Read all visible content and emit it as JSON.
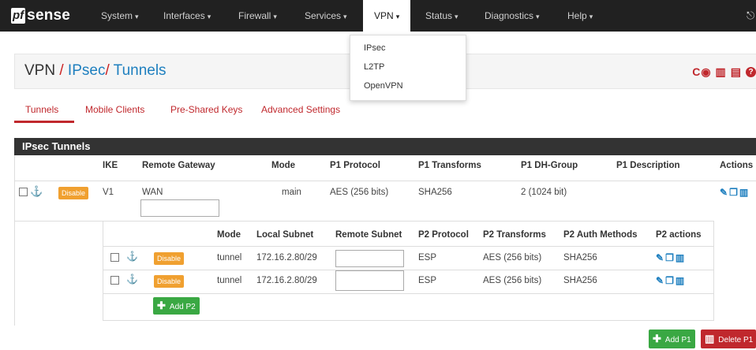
{
  "brand": {
    "box": "pf",
    "text": "sense"
  },
  "nav": {
    "system": "System",
    "interfaces": "Interfaces",
    "firewall": "Firewall",
    "services": "Services",
    "vpn": "VPN",
    "status": "Status",
    "diagnostics": "Diagnostics",
    "help": "Help",
    "caret": "▾"
  },
  "vpn_menu": [
    "IPsec",
    "L2TP",
    "OpenVPN"
  ],
  "breadcrumb": {
    "root": "VPN",
    "sep1": " / ",
    "ipsec": "IPsec",
    "sep2": "/ ",
    "tunnels": "Tunnels"
  },
  "header_icons": {
    "reload": "C",
    "status": "◉",
    "chart": "▥",
    "log": "▤",
    "help": "❓"
  },
  "tabs": [
    "Tunnels",
    "Mobile Clients",
    "Pre-Shared Keys",
    "Advanced Settings"
  ],
  "section_title": "IPsec Tunnels",
  "p1_headers": {
    "ike": "IKE",
    "remote_gateway": "Remote Gateway",
    "mode": "Mode",
    "p1_protocol": "P1 Protocol",
    "p1_transforms": "P1 Transforms",
    "p1_dh_group": "P1 DH-Group",
    "p1_description": "P1 Description",
    "actions": "Actions"
  },
  "p1_row": {
    "badge": "Disable",
    "ike": "V1",
    "remote_gateway": "WAN",
    "mode": "main",
    "p1_protocol": "AES (256 bits)",
    "p1_transforms": "SHA256",
    "p1_dh_group": "2 (1024 bit)",
    "p1_description": ""
  },
  "p2_headers": {
    "mode": "Mode",
    "local_subnet": "Local Subnet",
    "remote_subnet": "Remote Subnet",
    "p2_protocol": "P2 Protocol",
    "p2_transforms": "P2 Transforms",
    "p2_auth": "P2 Auth Methods",
    "p2_actions": "P2 actions"
  },
  "p2_rows": [
    {
      "badge": "Disable",
      "mode": "tunnel",
      "local_subnet": "172.16.2.80/29",
      "remote_subnet": "",
      "protocol": "ESP",
      "transforms": "AES (256 bits)",
      "auth": "SHA256"
    },
    {
      "badge": "Disable",
      "mode": "tunnel",
      "local_subnet": "172.16.2.80/29",
      "remote_subnet": "",
      "protocol": "ESP",
      "transforms": "AES (256 bits)",
      "auth": "SHA256"
    }
  ],
  "buttons": {
    "add_p2": "Add P2",
    "add_p1": "Add P1",
    "delete_p1": "Delete P1"
  },
  "icons": {
    "anchor": "⚓",
    "edit": "✎",
    "copy": "❐",
    "trash": "🗑",
    "plus": "✚"
  },
  "colors": {
    "navbar": "#212121",
    "link": "#1e7fbf",
    "accent_red": "#c0282d",
    "badge": "#f0a030",
    "green": "#3aa843"
  }
}
